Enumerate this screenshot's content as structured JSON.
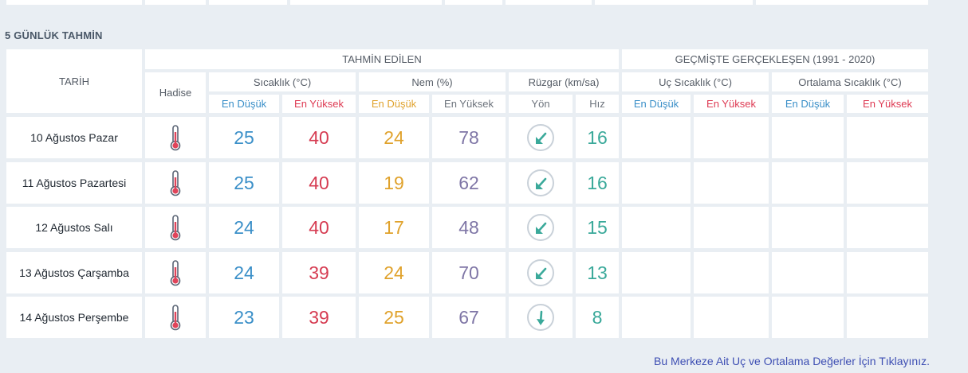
{
  "section_title": "5 GÜNLÜK TAHMİN",
  "headers": {
    "date": "TARİH",
    "forecast_group": "TAHMİN EDİLEN",
    "history_group": "GEÇMİŞTE GERÇEKLEŞEN (1991 - 2020)",
    "event": "Hadise",
    "temperature": "Sıcaklık (°C)",
    "humidity": "Nem (%)",
    "wind": "Rüzgar (km/sa)",
    "extreme_temp": "Uç Sıcaklık (°C)",
    "avg_temp": "Ortalama Sıcaklık (°C)",
    "low": "En Düşük",
    "high": "En Yüksek",
    "direction": "Yön",
    "speed": "Hız"
  },
  "rows": [
    {
      "date": "10 Ağustos Pazar",
      "event_icon": "thermometer-hot-icon",
      "temp_low": "25",
      "temp_high": "40",
      "hum_low": "24",
      "hum_high": "78",
      "wind_dir_icon": "arrow-southwest-icon",
      "wind_speed": "16"
    },
    {
      "date": "11 Ağustos Pazartesi",
      "event_icon": "thermometer-hot-icon",
      "temp_low": "25",
      "temp_high": "40",
      "hum_low": "19",
      "hum_high": "62",
      "wind_dir_icon": "arrow-southwest-icon",
      "wind_speed": "16"
    },
    {
      "date": "12 Ağustos Salı",
      "event_icon": "thermometer-hot-icon",
      "temp_low": "24",
      "temp_high": "40",
      "hum_low": "17",
      "hum_high": "48",
      "wind_dir_icon": "arrow-southwest-icon",
      "wind_speed": "15"
    },
    {
      "date": "13 Ağustos Çarşamba",
      "event_icon": "thermometer-hot-icon",
      "temp_low": "24",
      "temp_high": "39",
      "hum_low": "24",
      "hum_high": "70",
      "wind_dir_icon": "arrow-southwest-icon",
      "wind_speed": "13"
    },
    {
      "date": "14 Ağustos Perşembe",
      "event_icon": "thermometer-hot-icon",
      "temp_low": "23",
      "temp_high": "39",
      "hum_low": "25",
      "hum_high": "67",
      "wind_dir_icon": "arrow-south-icon",
      "wind_speed": "8"
    }
  ],
  "footer_link": "Bu Merkeze Ait Uç ve Ortalama Değerler İçin Tıklayınız.",
  "colors": {
    "low": "#3a8fc8",
    "high": "#d63c52",
    "humidity_low": "#e0a22c",
    "humidity_high": "#7f76a6",
    "wind": "#3aa99a",
    "link": "#3e4fb3"
  }
}
